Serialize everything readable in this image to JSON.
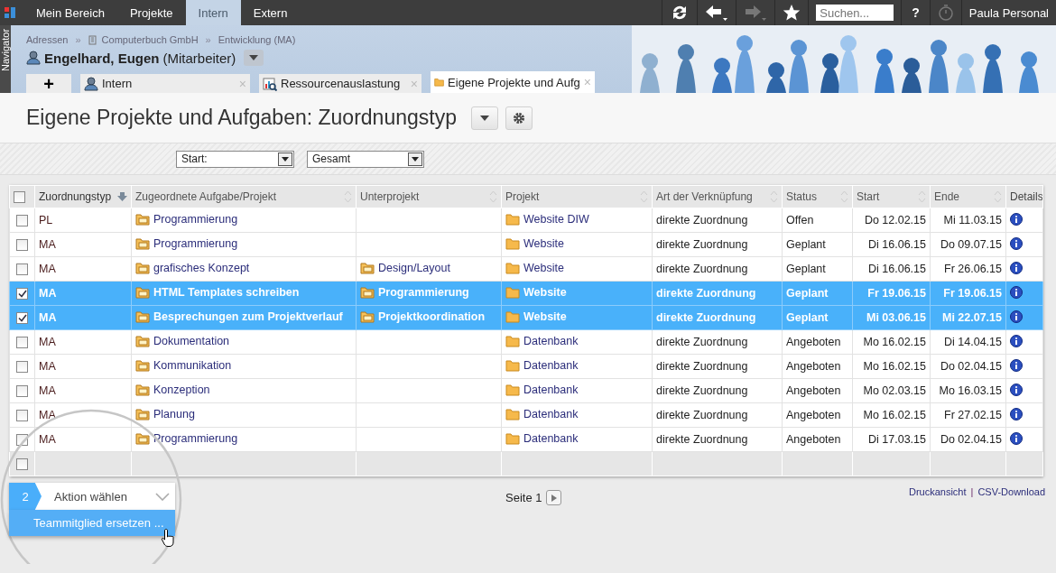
{
  "top_nav": {
    "items": [
      {
        "label": "Mein Bereich",
        "selected": false
      },
      {
        "label": "Projekte",
        "selected": false
      },
      {
        "label": "Intern",
        "selected": true
      },
      {
        "label": "Extern",
        "selected": false
      }
    ],
    "toolbar": [
      {
        "kind": "refresh",
        "disabled": false
      },
      {
        "kind": "back",
        "disabled": false
      },
      {
        "kind": "forward",
        "disabled": true
      },
      {
        "kind": "star",
        "disabled": false
      }
    ],
    "search": {
      "placeholder": "Suchen..."
    },
    "help": "?",
    "user": "Paula Personal"
  },
  "navigator": "Navigator",
  "breadcrumb": [
    {
      "label": "Adressen",
      "kind": "plain"
    },
    {
      "label": "Computerbuch GmbH",
      "kind": "company"
    },
    {
      "label": "Entwicklung (MA)",
      "kind": "plain"
    }
  ],
  "breadcrumb_separator": "»",
  "person": {
    "name": "Engelhard, Eugen",
    "role": "(Mitarbeiter)"
  },
  "doc_tabs": {
    "add": "+",
    "tabs": [
      {
        "label": "Intern",
        "kind": "person",
        "selected": false,
        "close": "×"
      },
      {
        "label": "Ressourcenauslastung",
        "kind": "chart",
        "selected": false,
        "close": "×"
      },
      {
        "label": "Eigene Projekte und Aufg",
        "kind": "folder",
        "selected": true,
        "close": "×"
      }
    ]
  },
  "page_title": "Eigene Projekte und Aufgaben: Zuordnungstyp",
  "filters": [
    {
      "value": "Start:"
    },
    {
      "value": "Gesamt"
    }
  ],
  "table": {
    "select_all_checked": false,
    "columns": [
      {
        "label": "Zuordnungstyp",
        "sortable": true,
        "sorted": true
      },
      {
        "label": "Zugeordnete Aufgabe/Projekt",
        "sortable": true,
        "sorted": false
      },
      {
        "label": "Unterprojekt",
        "sortable": true,
        "sorted": false
      },
      {
        "label": "Projekt",
        "sortable": true,
        "sorted": false
      },
      {
        "label": "Art der Verknüpfung",
        "sortable": true,
        "sorted": false
      },
      {
        "label": "Status",
        "sortable": true,
        "sorted": false
      },
      {
        "label": "Start",
        "sortable": true,
        "sorted": false
      },
      {
        "label": "Ende",
        "sortable": true,
        "sorted": false
      },
      {
        "label": "Details",
        "sortable": false
      }
    ],
    "rows": [
      {
        "selected": false,
        "type": "PL",
        "task": "Programmierung",
        "subproject": "",
        "project": "Website DIW",
        "link": "direkte Zuordnung",
        "status": "Offen",
        "start": "Do 12.02.15",
        "end": "Mi 11.03.15"
      },
      {
        "selected": false,
        "type": "MA",
        "task": "Programmierung",
        "subproject": "",
        "project": "Website",
        "link": "direkte Zuordnung",
        "status": "Geplant",
        "start": "Di 16.06.15",
        "end": "Do 09.07.15"
      },
      {
        "selected": false,
        "type": "MA",
        "task": "grafisches Konzept",
        "subproject": "Design/Layout",
        "project": "Website",
        "link": "direkte Zuordnung",
        "status": "Geplant",
        "start": "Di 16.06.15",
        "end": "Fr 26.06.15"
      },
      {
        "selected": true,
        "type": "MA",
        "task": "HTML Templates schreiben",
        "subproject": "Programmierung",
        "project": "Website",
        "link": "direkte Zuordnung",
        "status": "Geplant",
        "start": "Fr 19.06.15",
        "end": "Fr 19.06.15"
      },
      {
        "selected": true,
        "type": "MA",
        "task": "Besprechungen zum Projektverlauf",
        "subproject": "Projektkoordination",
        "project": "Website",
        "link": "direkte Zuordnung",
        "status": "Geplant",
        "start": "Mi 03.06.15",
        "end": "Mi 22.07.15"
      },
      {
        "selected": false,
        "type": "MA",
        "task": "Dokumentation",
        "subproject": "",
        "project": "Datenbank",
        "link": "direkte Zuordnung",
        "status": "Angeboten",
        "start": "Mo 16.02.15",
        "end": "Di 14.04.15"
      },
      {
        "selected": false,
        "type": "MA",
        "task": "Kommunikation",
        "subproject": "",
        "project": "Datenbank",
        "link": "direkte Zuordnung",
        "status": "Angeboten",
        "start": "Mo 16.02.15",
        "end": "Do 02.04.15"
      },
      {
        "selected": false,
        "type": "MA",
        "task": "Konzeption",
        "subproject": "",
        "project": "Datenbank",
        "link": "direkte Zuordnung",
        "status": "Angeboten",
        "start": "Mo 02.03.15",
        "end": "Mo 16.03.15"
      },
      {
        "selected": false,
        "type": "MA",
        "task": "Planung",
        "subproject": "",
        "project": "Datenbank",
        "link": "direkte Zuordnung",
        "status": "Angeboten",
        "start": "Mo 16.02.15",
        "end": "Fr 27.02.15"
      },
      {
        "selected": false,
        "type": "MA",
        "task": "Programmierung",
        "subproject": "",
        "project": "Datenbank",
        "link": "direkte Zuordnung",
        "status": "Angeboten",
        "start": "Di 17.03.15",
        "end": "Do 02.04.15"
      }
    ],
    "blank_row_checked": false
  },
  "action_bar": {
    "count": "2",
    "label": "Aktion wählen",
    "menu_item": "Teammitglied ersetzen ..."
  },
  "pager": {
    "label": "Seite 1"
  },
  "links": [
    "Druckansicht",
    "CSV-Download"
  ],
  "link_separator": "|"
}
